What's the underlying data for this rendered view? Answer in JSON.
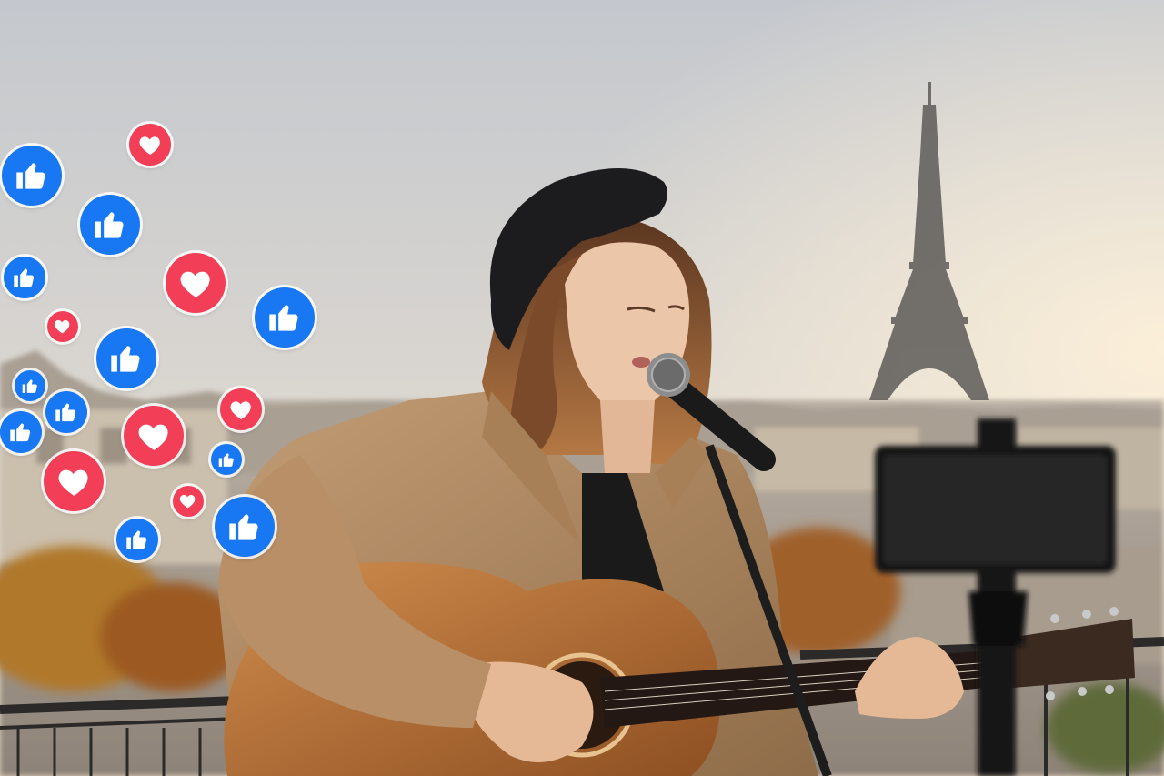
{
  "scene": {
    "description_icons": [
      "eiffel-tower",
      "singer",
      "acoustic-guitar",
      "microphone",
      "phone-on-tripod"
    ],
    "colors": {
      "sky_top": "#c7cbd1",
      "sky_bottom": "#e8dccd",
      "like_blue": "#1877f2",
      "love_red": "#f33e58",
      "coat": "#b08a62",
      "beret": "#1c1c1e",
      "guitar": "#b8743a"
    }
  },
  "reactions": [
    {
      "type": "like-icon",
      "size": "large"
    },
    {
      "type": "love-icon",
      "size": "medium"
    },
    {
      "type": "like-icon",
      "size": "large"
    },
    {
      "type": "like-icon",
      "size": "medium"
    },
    {
      "type": "love-icon",
      "size": "large"
    },
    {
      "type": "like-icon",
      "size": "large"
    },
    {
      "type": "love-icon",
      "size": "small"
    },
    {
      "type": "like-icon",
      "size": "large"
    },
    {
      "type": "like-icon",
      "size": "small"
    },
    {
      "type": "like-icon",
      "size": "medium"
    },
    {
      "type": "love-icon",
      "size": "medium"
    },
    {
      "type": "like-icon",
      "size": "medium"
    },
    {
      "type": "love-icon",
      "size": "large"
    },
    {
      "type": "like-icon",
      "size": "small"
    },
    {
      "type": "love-icon",
      "size": "large"
    },
    {
      "type": "love-icon",
      "size": "small"
    },
    {
      "type": "like-icon",
      "size": "large"
    },
    {
      "type": "like-icon",
      "size": "medium"
    }
  ]
}
